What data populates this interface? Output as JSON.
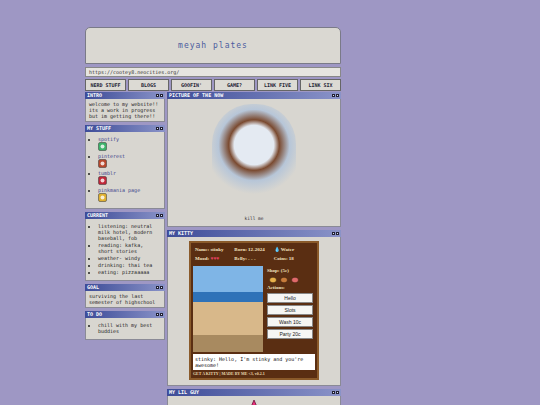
{
  "site": {
    "title": "meyah plates",
    "url": "https://cootey8.neocities.org/"
  },
  "nav": [
    {
      "label": "NERD STUFF"
    },
    {
      "label": "BLOGS"
    },
    {
      "label": "GOOFIN'"
    },
    {
      "label": "GAME?"
    },
    {
      "label": "LINK FIVE"
    },
    {
      "label": "LINK SIX"
    }
  ],
  "intro": {
    "title": "INTRO",
    "text": "welcome to my website!! its a work in progress but im getting there!!"
  },
  "my_stuff": {
    "title": "MY STUFF",
    "links": [
      {
        "label": "spotify",
        "color": "#3bb36a"
      },
      {
        "label": "pinterest",
        "color": "#b8482e"
      },
      {
        "label": "tumblr",
        "color": "#c0283a"
      },
      {
        "label": "pinkmania page",
        "color": "#e0b030"
      }
    ]
  },
  "current": {
    "title": "CURRENT",
    "items": [
      "listening: neutral milk hotel, modern baseball, fob",
      "reading: kafka, short stories",
      "weather- windy",
      "drinking: thai tea",
      "eating: pizzaaaaa"
    ]
  },
  "goal": {
    "title": "GOAL",
    "text": "surviving the last semester of highschool"
  },
  "todo": {
    "title": "TO DO",
    "items": [
      "chill with my best buddies"
    ]
  },
  "picture": {
    "title": "PICTURE OF THE NOW",
    "caption": "kill me"
  },
  "kitty": {
    "title": "MY KITTY",
    "stats": [
      {
        "label": "Name:",
        "value": "stinky"
      },
      {
        "label": "Born:",
        "value": "12-2024"
      },
      {
        "label": "💧",
        "value": "Water"
      },
      {
        "label": "Mood:",
        "value": "♥♥♥"
      },
      {
        "label": "Belly:",
        "value": "- - -"
      },
      {
        "label": "Coins:",
        "value": "18"
      }
    ],
    "shop_title": "Shop: (5c)",
    "shop_items": [
      {
        "color": "#e8b04a"
      },
      {
        "color": "#c77b3a"
      },
      {
        "color": "#e06a6a"
      }
    ],
    "actions_title": "Actions:",
    "actions": [
      "Hello",
      "Slots",
      "Wash 10c",
      "Party 20c"
    ],
    "message": "stinky: Hello, I'm stinky and you're awesome!",
    "footer": "GET A KITTY | MADE BY ME <3, v0.2.1"
  },
  "lil_guy": {
    "title": "MY LIL GUY"
  }
}
